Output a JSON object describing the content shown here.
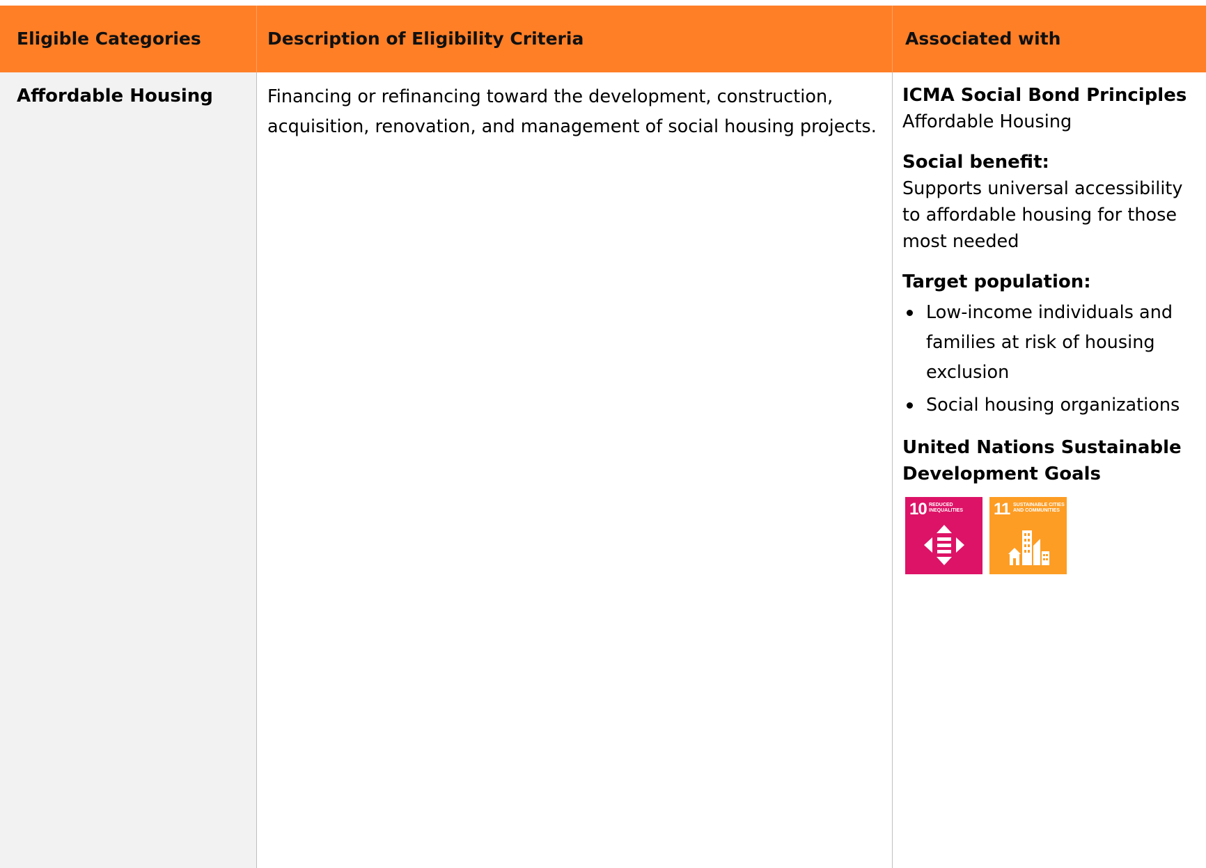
{
  "table": {
    "headers": {
      "col1": "Eligible Categories",
      "col2": "Description of Eligibility Criteria",
      "col3": "Associated with"
    },
    "row": {
      "category": "Affordable Housing",
      "description": "Financing or refinancing toward the development, construction, acquisition, renovation, and management of social housing projects.",
      "associated": {
        "principles_heading": "ICMA Social Bond Principles",
        "principles_value": "Affordable Housing",
        "benefit_heading": "Social benefit:",
        "benefit_text": "Supports universal accessibility to affordable housing for those most needed",
        "target_heading": "Target population:",
        "target_items": [
          "Low-income individuals and families at risk of housing exclusion",
          "Social housing organizations"
        ],
        "sdg_heading": "United Nations Sustainable Development Goals",
        "sdg_badges": [
          {
            "number": "10",
            "title": "REDUCED INEQUALITIES",
            "color": "#DD1367",
            "icon": "reduced-inequalities-icon"
          },
          {
            "number": "11",
            "title": "SUSTAINABLE CITIES AND COMMUNITIES",
            "color": "#FD9D24",
            "icon": "sustainable-cities-icon"
          }
        ]
      }
    },
    "colors": {
      "header_bg": "#FF7F27",
      "first_col_bg": "#F2F2F2",
      "grid": "#BFBFBF"
    }
  }
}
